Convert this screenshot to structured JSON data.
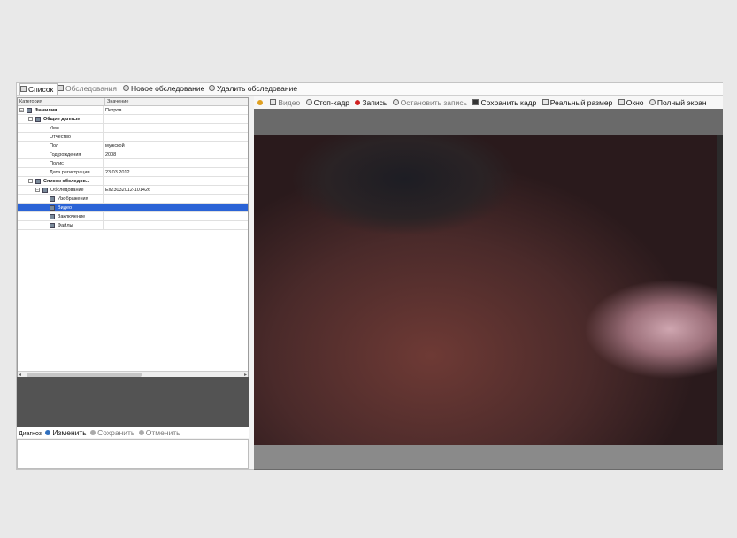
{
  "top_tabs": [
    {
      "label": "Список",
      "icon": "list-icon"
    },
    {
      "label": "Обследования",
      "icon": "exams-icon"
    },
    {
      "label": "Новое обследование",
      "icon": "new-exam-icon"
    },
    {
      "label": "Удалить обследование",
      "icon": "delete-exam-icon"
    }
  ],
  "tree": {
    "col_category": "Категория",
    "col_value": "Значение",
    "rows": [
      {
        "key": "Фамилия",
        "value": "Петров"
      },
      {
        "key": "Общие данные",
        "value": ""
      },
      {
        "key": "Имя",
        "value": ""
      },
      {
        "key": "Отчество",
        "value": ""
      },
      {
        "key": "Пол",
        "value": "мужской"
      },
      {
        "key": "Год рождения",
        "value": "2008"
      },
      {
        "key": "Полис",
        "value": ""
      },
      {
        "key": "Дата регистрации",
        "value": "23.03.2012"
      },
      {
        "key": "Список обследов...",
        "value": ""
      },
      {
        "key": "Обследование",
        "value": "Ex23032012-101426"
      },
      {
        "key": "Изображения",
        "value": ""
      },
      {
        "key": "Видео",
        "value": ""
      },
      {
        "key": "Заключение",
        "value": ""
      },
      {
        "key": "Файлы",
        "value": ""
      }
    ]
  },
  "diag_bar": {
    "label": "Диагноз",
    "edit": "Изменить",
    "save": "Сохранить",
    "cancel": "Отменить"
  },
  "video_toolbar": {
    "video": "Видео",
    "stop_frame": "Стоп-кадр",
    "record": "Запись",
    "stop_record": "Остановить запись",
    "save_frame": "Сохранить кадр",
    "real_size": "Реальный размер",
    "window": "Окно",
    "fullscreen": "Полный экран"
  },
  "colors": {
    "selected_row": "#2a63d6",
    "record_dot": "#d02020"
  }
}
